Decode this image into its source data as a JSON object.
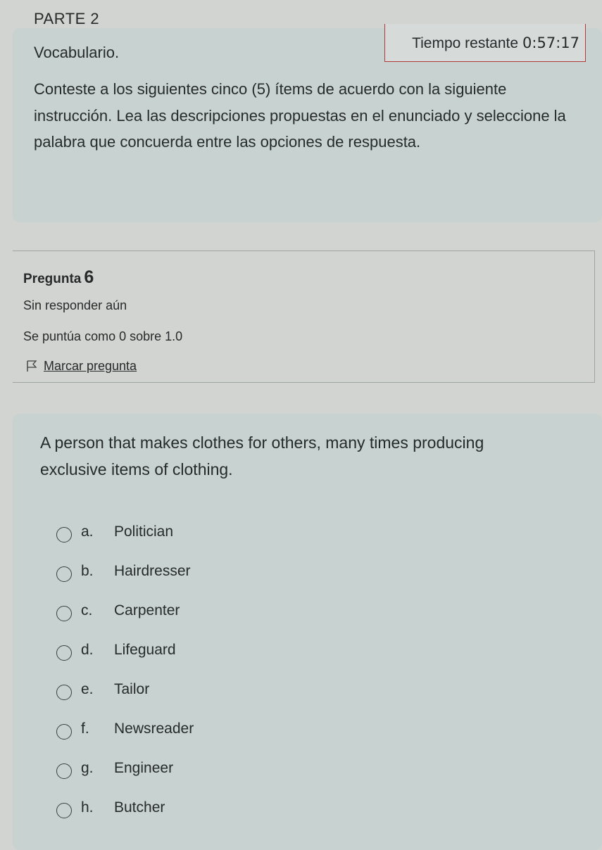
{
  "header": {
    "part_title": "PARTE 2",
    "section": "Vocabulario.",
    "timer_label": "Tiempo restante",
    "timer_value": "0:57:17"
  },
  "instructions": "Conteste a los siguientes cinco (5) ítems de acuerdo con la siguiente instrucción. Lea las descripciones propuestas en el enunciado y seleccione la palabra que concuerda entre las opciones de respuesta.",
  "question_info": {
    "label": "Pregunta",
    "number": "6",
    "status": "Sin responder aún",
    "grade": "Se puntúa como 0 sobre 1.0",
    "flag_label": "Marcar pregunta",
    "flag_icon": "flag-icon"
  },
  "question": {
    "text": "A person that makes clothes for others, many times producing exclusive items of clothing.",
    "options": [
      {
        "letter": "a.",
        "text": "Politician"
      },
      {
        "letter": "b.",
        "text": "Hairdresser"
      },
      {
        "letter": "c.",
        "text": "Carpenter"
      },
      {
        "letter": "d.",
        "text": "Lifeguard"
      },
      {
        "letter": "e.",
        "text": "Tailor"
      },
      {
        "letter": "f.",
        "text": "Newsreader"
      },
      {
        "letter": "g.",
        "text": "Engineer"
      },
      {
        "letter": "h.",
        "text": "Butcher"
      }
    ]
  },
  "colors": {
    "page_background": "#d2d4d1",
    "panel_background": "#c8d2d1",
    "timer_border": "#b03a3a",
    "text": "#262a2b"
  }
}
